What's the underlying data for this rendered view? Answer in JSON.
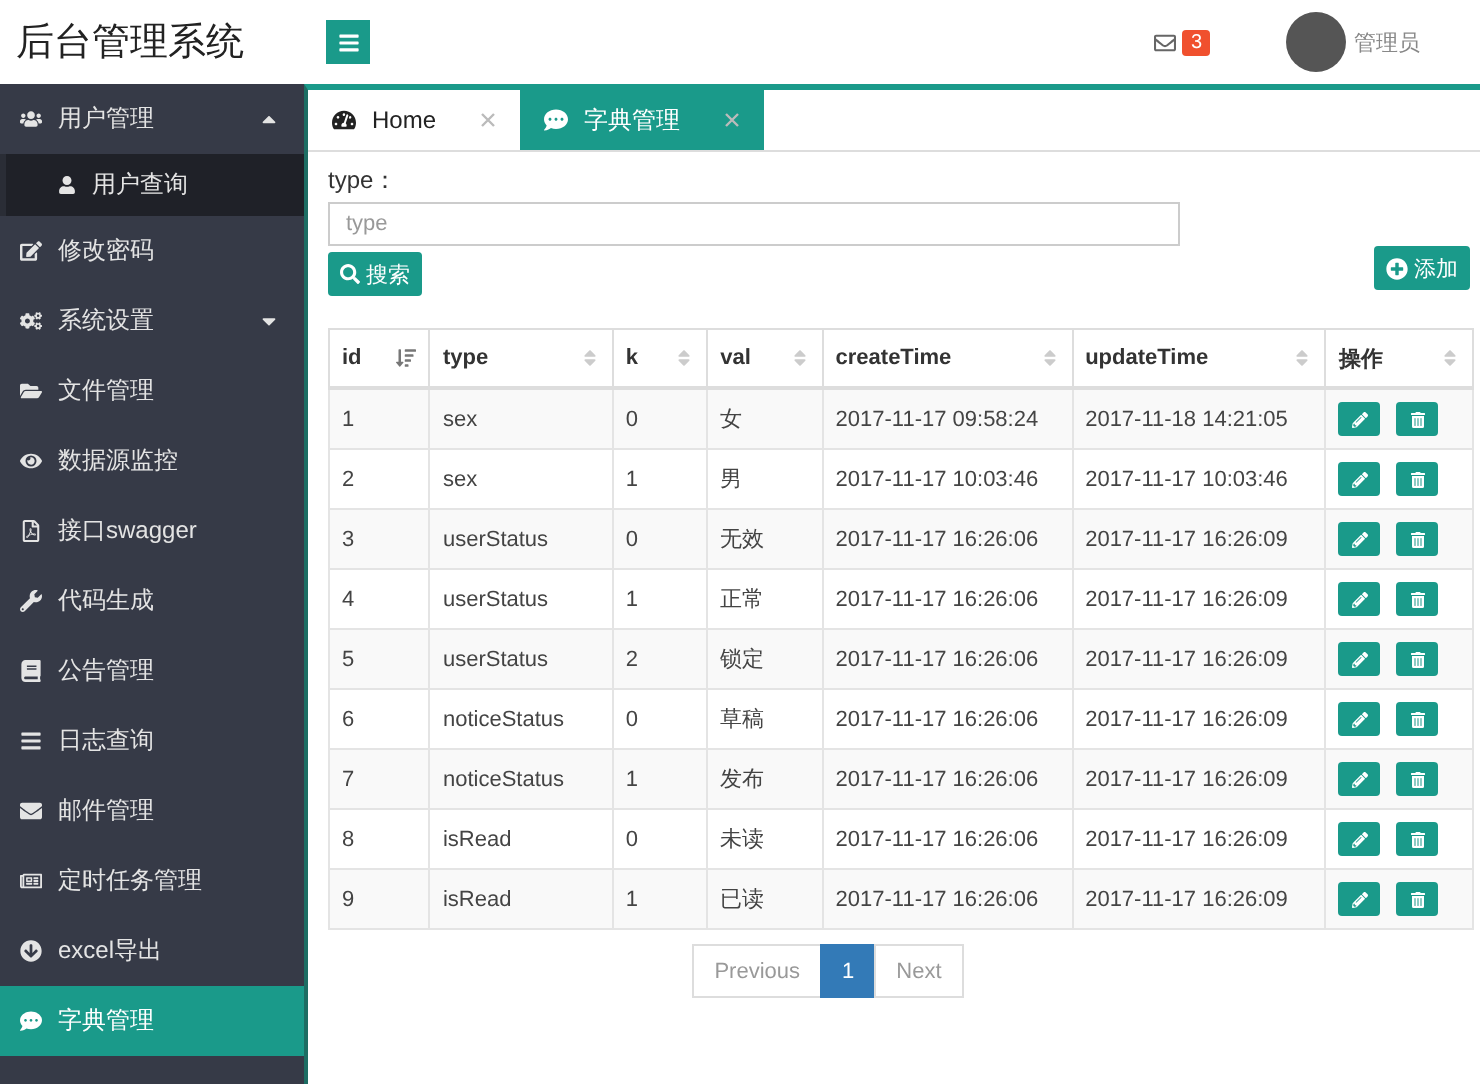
{
  "header": {
    "title": "后台管理系统",
    "mail_count": "3",
    "user_name": "管理员"
  },
  "sidebar": {
    "items": [
      {
        "label": "用户管理",
        "expanded": true,
        "selected": false,
        "children": [
          {
            "label": "用户查询",
            "selected": false
          }
        ]
      },
      {
        "label": "修改密码",
        "selected": false
      },
      {
        "label": "系统设置",
        "expanded": false,
        "selected": false
      },
      {
        "label": "文件管理",
        "selected": false
      },
      {
        "label": "数据源监控",
        "selected": false
      },
      {
        "label": "接口swagger",
        "selected": false
      },
      {
        "label": "代码生成",
        "selected": false
      },
      {
        "label": "公告管理",
        "selected": false
      },
      {
        "label": "日志查询",
        "selected": false
      },
      {
        "label": "邮件管理",
        "selected": false
      },
      {
        "label": "定时任务管理",
        "selected": false
      },
      {
        "label": "excel导出",
        "selected": false
      },
      {
        "label": "字典管理",
        "selected": true
      }
    ]
  },
  "tabs": [
    {
      "label": "Home",
      "selected": false
    },
    {
      "label": "字典管理",
      "selected": true
    }
  ],
  "search": {
    "label": "type：",
    "placeholder": "type",
    "button": "搜索",
    "add_button": "添加"
  },
  "table": {
    "columns": [
      {
        "label": "id",
        "sorted": true
      },
      {
        "label": "type",
        "sorted": false
      },
      {
        "label": "k",
        "sorted": false
      },
      {
        "label": "val",
        "sorted": false
      },
      {
        "label": "createTime",
        "sorted": false
      },
      {
        "label": "updateTime",
        "sorted": false
      },
      {
        "label": "操作",
        "sorted": false
      }
    ],
    "rows": [
      [
        "1",
        "sex",
        "0",
        "女",
        "2017-11-17 09:58:24",
        "2017-11-18 14:21:05"
      ],
      [
        "2",
        "sex",
        "1",
        "男",
        "2017-11-17 10:03:46",
        "2017-11-17 10:03:46"
      ],
      [
        "3",
        "userStatus",
        "0",
        "无效",
        "2017-11-17 16:26:06",
        "2017-11-17 16:26:09"
      ],
      [
        "4",
        "userStatus",
        "1",
        "正常",
        "2017-11-17 16:26:06",
        "2017-11-17 16:26:09"
      ],
      [
        "5",
        "userStatus",
        "2",
        "锁定",
        "2017-11-17 16:26:06",
        "2017-11-17 16:26:09"
      ],
      [
        "6",
        "noticeStatus",
        "0",
        "草稿",
        "2017-11-17 16:26:06",
        "2017-11-17 16:26:09"
      ],
      [
        "7",
        "noticeStatus",
        "1",
        "发布",
        "2017-11-17 16:26:06",
        "2017-11-17 16:26:09"
      ],
      [
        "8",
        "isRead",
        "0",
        "未读",
        "2017-11-17 16:26:06",
        "2017-11-17 16:26:09"
      ],
      [
        "9",
        "isRead",
        "1",
        "已读",
        "2017-11-17 16:26:06",
        "2017-11-17 16:26:09"
      ]
    ]
  },
  "pagination": {
    "previous": "Previous",
    "pages": [
      {
        "label": "1",
        "selected": true
      }
    ],
    "next": "Next"
  }
}
